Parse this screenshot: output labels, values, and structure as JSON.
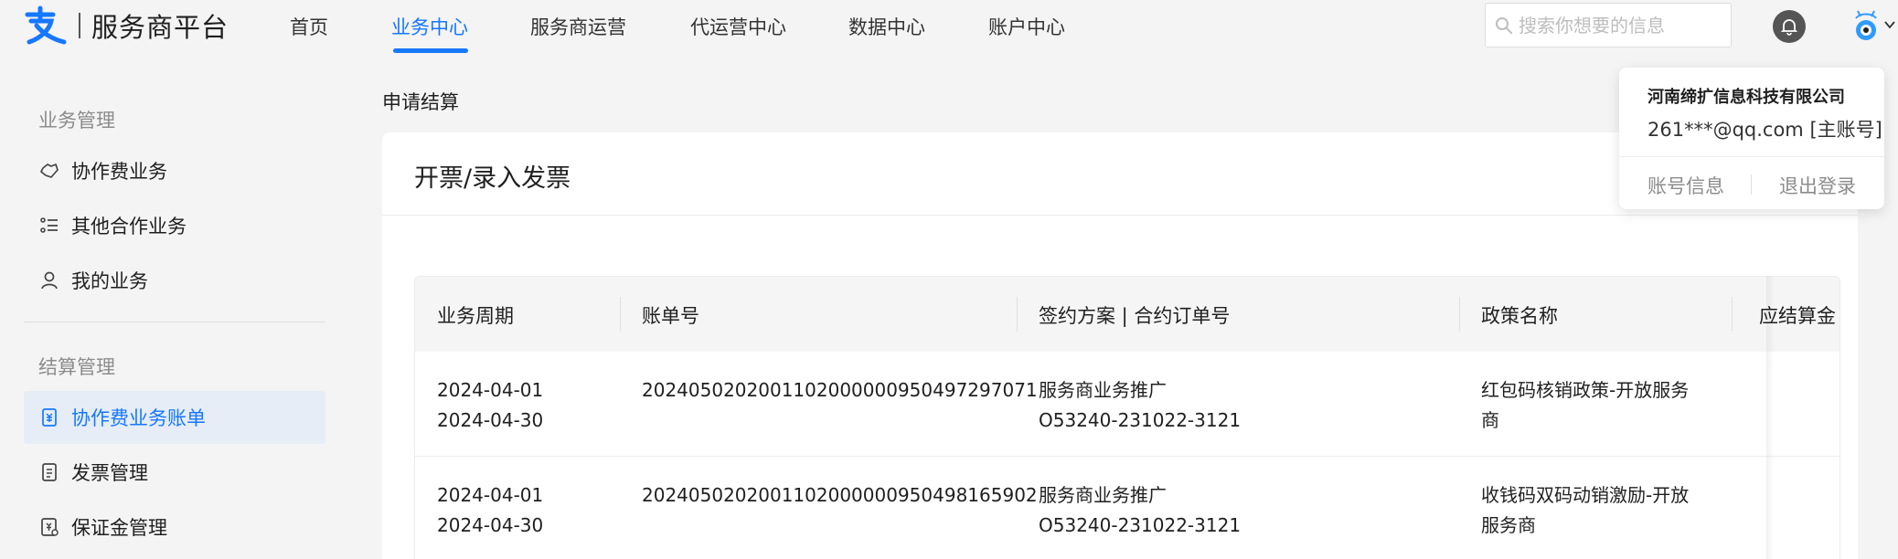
{
  "header": {
    "platform_name": "服务商平台",
    "nav": [
      {
        "label": "首页"
      },
      {
        "label": "业务中心",
        "active": true
      },
      {
        "label": "服务商运营"
      },
      {
        "label": "代运营中心"
      },
      {
        "label": "数据中心"
      },
      {
        "label": "账户中心"
      }
    ],
    "search_placeholder": "搜索你想要的信息",
    "accent_color": "#1677ff"
  },
  "sidebar": {
    "groups": [
      {
        "title": "业务管理",
        "items": [
          {
            "label": "协作费业务",
            "icon": "handshake-icon"
          },
          {
            "label": "其他合作业务",
            "icon": "list-icon"
          },
          {
            "label": "我的业务",
            "icon": "user-icon"
          }
        ]
      },
      {
        "title": "结算管理",
        "items": [
          {
            "label": "协作费业务账单",
            "icon": "bill-icon",
            "active": true
          },
          {
            "label": "发票管理",
            "icon": "invoice-icon"
          },
          {
            "label": "保证金管理",
            "icon": "deposit-icon"
          }
        ]
      }
    ]
  },
  "main": {
    "breadcrumb": "申请结算",
    "card_title": "开票/录入发票",
    "table": {
      "columns": [
        "业务周期",
        "账单号",
        "签约方案 | 合约订单号",
        "政策名称",
        "应结算金"
      ],
      "rows": [
        {
          "period_start": "2024-04-01",
          "period_end": "2024-04-30",
          "bill_no": "2024050202001102000000950497297071",
          "plan": "服务商业务推广",
          "contract_no": "O53240-231022-3121",
          "policy_line1": "红包码核销政策-开放服务",
          "policy_line2": "商"
        },
        {
          "period_start": "2024-04-01",
          "period_end": "2024-04-30",
          "bill_no": "2024050202001102000000950498165902",
          "plan": "服务商业务推广",
          "contract_no": "O53240-231022-3121",
          "policy_line1": "收钱码双码动销激励-开放",
          "policy_line2": "服务商"
        }
      ]
    }
  },
  "account_menu": {
    "company": "河南缔扩信息科技有限公司",
    "email": "261***@qq.com [主账号]",
    "account_info": "账号信息",
    "logout": "退出登录"
  }
}
